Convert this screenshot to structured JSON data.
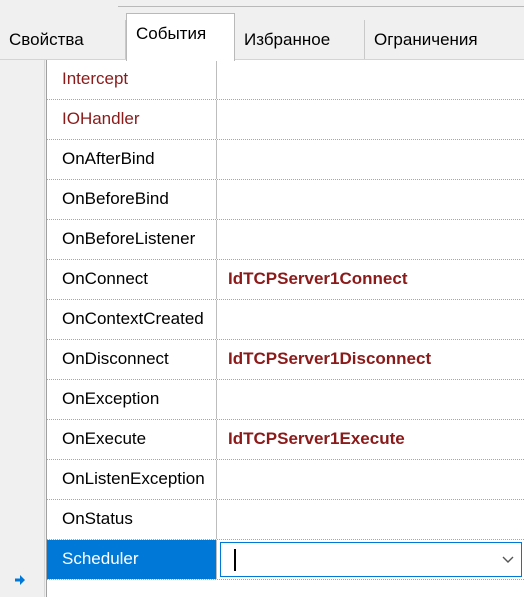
{
  "tabs": [
    {
      "label": "Свойства",
      "active": false
    },
    {
      "label": "События",
      "active": true
    },
    {
      "label": "Избранное",
      "active": false
    },
    {
      "label": "Ограничения",
      "active": false
    }
  ],
  "rows": [
    {
      "name": "Intercept",
      "value": ""
    },
    {
      "name": "IOHandler",
      "value": ""
    },
    {
      "name": "OnAfterBind",
      "value": ""
    },
    {
      "name": "OnBeforeBind",
      "value": ""
    },
    {
      "name": "OnBeforeListener",
      "value": ""
    },
    {
      "name": "OnConnect",
      "value": "IdTCPServer1Connect"
    },
    {
      "name": "OnContextCreated",
      "value": ""
    },
    {
      "name": "OnDisconnect",
      "value": "IdTCPServer1Disconnect"
    },
    {
      "name": "OnException",
      "value": ""
    },
    {
      "name": "OnExecute",
      "value": "IdTCPServer1Execute"
    },
    {
      "name": "OnListenException",
      "value": ""
    },
    {
      "name": "OnStatus",
      "value": ""
    },
    {
      "name": "Scheduler",
      "value": ""
    }
  ],
  "colors": {
    "reference_name": "#8b1a1a",
    "handler_value": "#8b1a1a",
    "selection": "#0078d7"
  },
  "icons": {
    "row_marker": "arrow-right-icon",
    "dropdown": "chevron-down-icon"
  }
}
